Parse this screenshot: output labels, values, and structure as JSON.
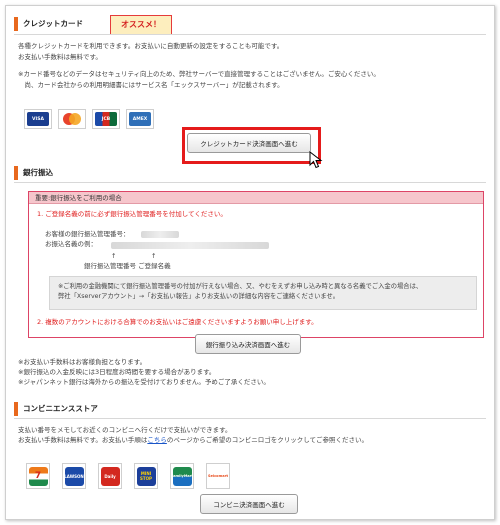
{
  "credit": {
    "heading": "クレジットカード",
    "badge": "オススメ！",
    "desc1": "各種クレジットカードを利用できます。お支払いに自動更新の設定をすることも可能です。",
    "desc2": "お支払い手数料は無料です。",
    "note1": "※カード番号などのデータはセキュリティ向上のため、弊社サーバーで直接管理することはございません。ご安心ください。",
    "note2": "　尚、カード会社からの利用明細書にはサービス名「エックスサーバー」が記載されます。",
    "cards": [
      {
        "label": "VISA",
        "color": "#1a3d8f"
      },
      {
        "label": "MasterCard",
        "color": "#e8432b"
      },
      {
        "label": "JCB",
        "color": "#0c6a3a"
      },
      {
        "label": "AMEX",
        "color": "#2f6fb8"
      }
    ],
    "button": "クレジットカード決済画面へ進む"
  },
  "bank": {
    "heading": "銀行振込",
    "box_title": "重要:銀行振込をご利用の場合",
    "item1": "1. ご登録名義の前に必ず銀行振込管理番号を付加してください。",
    "label_number": "お客様の銀行振込管理番号：",
    "label_name": "お振込名義の例：",
    "arrow": "↑",
    "caption": "銀行振込管理番号 ご登録名義",
    "notice1": "※ご利用の金融機関にて銀行振込管理番号の付加が行えない場合、又、やむをえずお申し込み時と異なる名義でご入金の場合は、",
    "notice2": "弊社「Xserverアカウント」→「お支払い報告」よりお支払いの詳細な内容をご連絡くださいませ。",
    "item2": "2. 複数のアカウントにおける合算でのお支払いはご遠慮くださいますようお願い申し上げます。",
    "button": "銀行振り込み決済画面へ進む",
    "after1": "※お支払い手数料はお客様負担となります。",
    "after2": "※銀行振込の入金反映には3日程度お時間を要する場合があります。",
    "after3": "※ジャパンネット銀行は海外からの振込を受付けておりません。予めご了承ください。"
  },
  "conv": {
    "heading": "コンビニエンスストア",
    "desc1": "支払い番号をメモしてお近くのコンビニへ行くだけで支払いができます。",
    "desc2_pre": "お支払い手数料は無料です。お支払い手順は",
    "desc2_link": "こちら",
    "desc2_post": "のページからご希望のコンビニロゴをクリックしてご参照ください。",
    "stores": [
      {
        "label": "7",
        "color": "#ee7a1a"
      },
      {
        "label": "LAWSON",
        "color": "#1b4aa8"
      },
      {
        "label": "Daily",
        "color": "#d3281f"
      },
      {
        "label": "MINI STOP",
        "color": "#1c3f9a"
      },
      {
        "label": "FamilyMart",
        "color": "#1f8a4c"
      },
      {
        "label": "Seicomart",
        "color": "#e84a1a"
      }
    ],
    "button": "コンビニ決済画面へ進む"
  }
}
